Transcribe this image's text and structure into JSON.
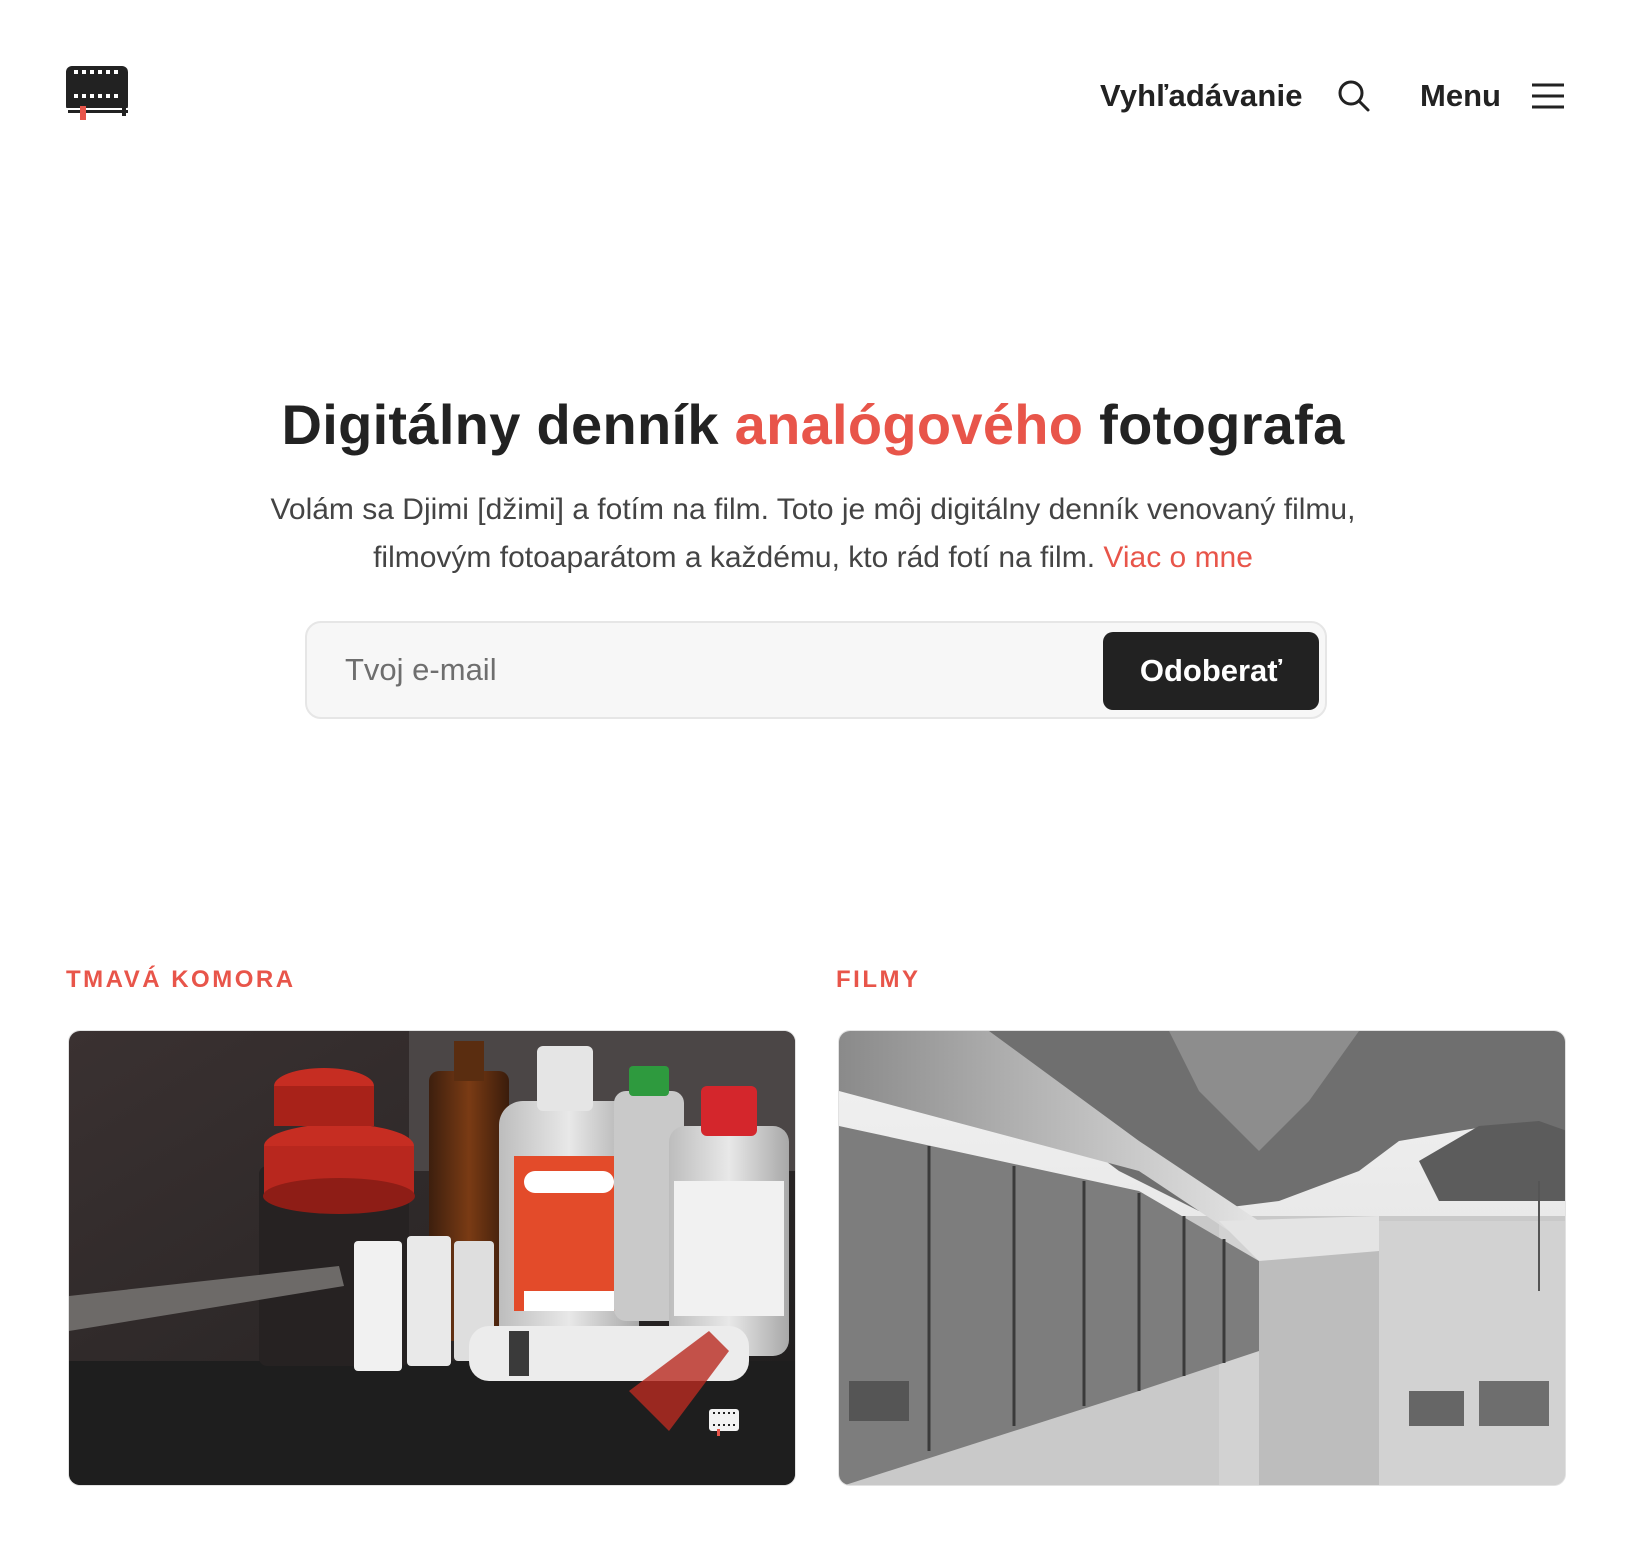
{
  "header": {
    "logo_name": "film-diary-logo",
    "search_label": "Vyhľadávanie",
    "menu_label": "Menu"
  },
  "hero": {
    "title_before": "Digitálny denník ",
    "title_accent": "analógového",
    "title_after": " fotografa",
    "description": "Volám sa Djimi [džimi] a fotím na film. Toto je môj digitálny denník venovaný filmu, filmovým fotoaparátom a každému, kto rád fotí na film. ",
    "more_link": "Viac o mne"
  },
  "subscribe": {
    "email_placeholder": "Tvoj e-mail",
    "email_value": "",
    "button_label": "Odoberať"
  },
  "posts": [
    {
      "category": "TMAVÁ KOMORA",
      "image_icon": "darkroom-chemicals-photo"
    },
    {
      "category": "FILMY",
      "image_icon": "airport-terminal-bw-photo"
    }
  ],
  "colors": {
    "accent": "#e8554a",
    "text": "#222222",
    "button_bg": "#222222",
    "input_bg": "#f7f7f7"
  }
}
